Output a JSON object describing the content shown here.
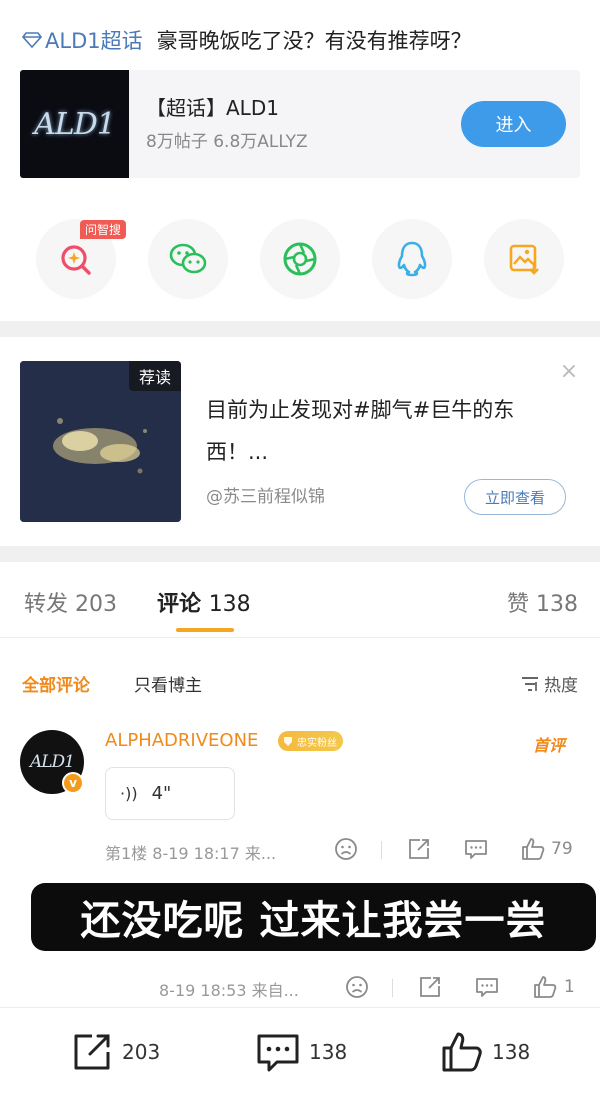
{
  "post": {
    "topic_link": "ALD1超话",
    "question": "豪哥晚饭吃了没？有没有推荐呀？"
  },
  "topic_card": {
    "logo_text": "ALD1",
    "name": "【超话】ALD1",
    "stats": "8万帖子 6.8万ALLYZ",
    "enter_label": "进入"
  },
  "share": {
    "zhisou_badge": "问智搜",
    "items": [
      "search-ai",
      "wechat",
      "moments",
      "qq",
      "save-image"
    ]
  },
  "recommend": {
    "tag": "荐读",
    "text": "目前为止发现对#脚气#巨牛的东西！...",
    "author": "@苏三前程似锦",
    "view_label": "立即查看",
    "close": "×"
  },
  "tabs": {
    "repost_label": "转发",
    "repost_count": "203",
    "comment_label": "评论",
    "comment_count": "138",
    "likes_label": "赞",
    "likes_count": "138"
  },
  "filters": {
    "all": "全部评论",
    "author_only": "只看博主",
    "hot": "热度"
  },
  "comment": {
    "avatar_text": "ALD1",
    "username": "ALPHADRIVEONE",
    "fan_badge": "忠实粉丝",
    "first_badge": "首评",
    "voice_duration": "4\"",
    "meta": "第1楼 8-19 18:17 来...",
    "likes": "79"
  },
  "subtitle": "还没吃呢 过来让我尝一尝",
  "reply": {
    "meta": "8-19 18:53 来自...",
    "likes": "1"
  },
  "bottom_bar": {
    "repost": "203",
    "comment": "138",
    "like": "138"
  },
  "colors": {
    "accent_orange": "#f08a1c",
    "link_blue": "#4a7ab8",
    "enter_blue": "#3d9be9"
  }
}
